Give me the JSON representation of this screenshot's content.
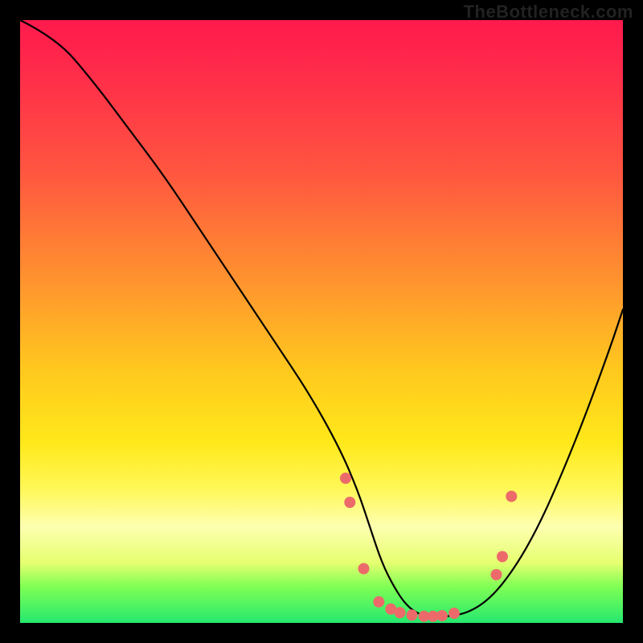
{
  "watermark": "TheBottleneck.com",
  "colors": {
    "frame": "#000000",
    "curve": "#000000",
    "dot": "#ed6a6a",
    "gradient_stops": [
      "#ff1a4d",
      "#ff2a4a",
      "#ff5540",
      "#ff8f30",
      "#ffc81e",
      "#ffe81a",
      "#fff85a",
      "#fdffb0",
      "#e6ff70",
      "#7fff55",
      "#25e86f"
    ]
  },
  "chart_data": {
    "type": "line",
    "title": "",
    "xlabel": "",
    "ylabel": "",
    "xlim": [
      0,
      100
    ],
    "ylim": [
      0,
      100
    ],
    "series": [
      {
        "name": "bottleneck-curve",
        "x": [
          0,
          6,
          12,
          18,
          24,
          30,
          36,
          42,
          48,
          53,
          56,
          58,
          60,
          62,
          64,
          66,
          68,
          70,
          74,
          78,
          82,
          86,
          90,
          94,
          98,
          100
        ],
        "y": [
          100,
          97,
          90,
          82,
          74,
          65,
          56,
          47,
          38,
          29,
          22,
          16,
          10,
          6,
          3,
          1.5,
          1,
          1,
          1.5,
          4,
          9,
          16,
          25,
          35,
          46,
          52
        ]
      }
    ],
    "markers": {
      "name": "highlight-dots",
      "x": [
        54,
        54.7,
        57,
        59.5,
        61.5,
        63,
        65,
        67,
        68.5,
        70,
        72,
        79,
        80,
        81.5
      ],
      "y": [
        24,
        20,
        9,
        3.5,
        2.3,
        1.7,
        1.3,
        1.1,
        1.1,
        1.2,
        1.6,
        8,
        11,
        21
      ]
    }
  }
}
